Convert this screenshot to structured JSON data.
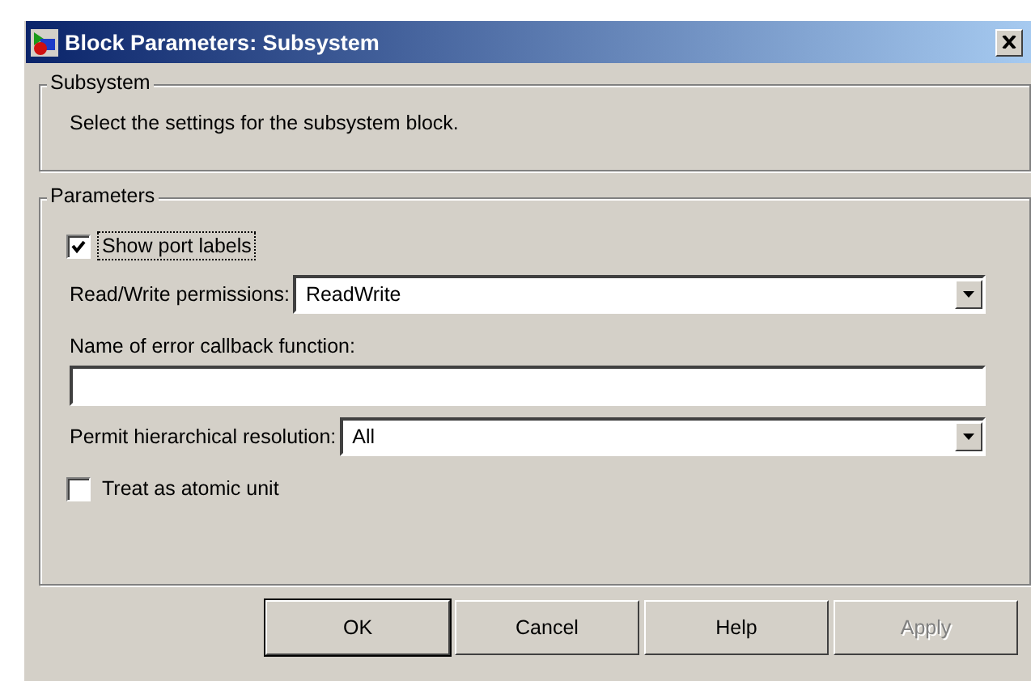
{
  "window": {
    "title": "Block Parameters: Subsystem"
  },
  "description_group": {
    "legend": "Subsystem",
    "text": "Select the settings for the subsystem block."
  },
  "parameters_group": {
    "legend": "Parameters",
    "items": [
      {
        "kind": "checkbox",
        "label": "Show port labels",
        "checked": true,
        "focused": true
      },
      {
        "kind": "dropdown",
        "label": "Read/Write permissions:",
        "value": "ReadWrite"
      },
      {
        "kind": "textfield",
        "label": "Name of error callback function:"
      },
      {
        "kind": "dropdown",
        "label": "Permit hierarchical resolution:",
        "value": "All"
      },
      {
        "kind": "checkbox",
        "label": "Treat as atomic unit",
        "checked": false,
        "focused": false
      }
    ]
  },
  "buttons": [
    {
      "label": "OK",
      "disabled": false,
      "default": true
    },
    {
      "label": "Cancel",
      "disabled": false,
      "default": false
    },
    {
      "label": "Help",
      "disabled": false,
      "default": false
    },
    {
      "label": "Apply",
      "disabled": true,
      "default": false
    }
  ]
}
